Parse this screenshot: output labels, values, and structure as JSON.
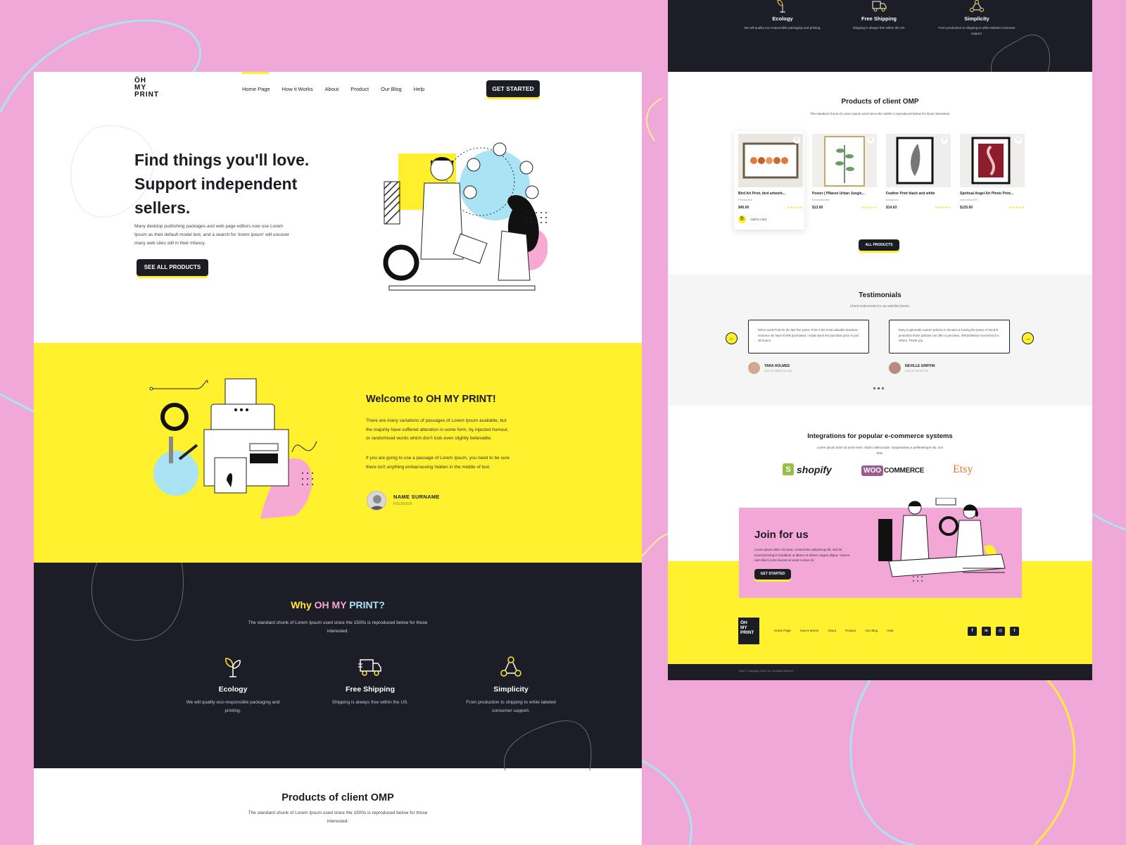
{
  "colors": {
    "background": "#f0a8d8",
    "yellow": "#fff12e",
    "dark": "#1c1d26",
    "pink": "#f3a7d6",
    "cyan": "#a9e3f4"
  },
  "left": {
    "logo": [
      "ÖH",
      "MY",
      "PRINT"
    ],
    "nav": [
      "Home Page",
      "How it Works",
      "About",
      "Product",
      "Our Blog",
      "Help"
    ],
    "get_started": "GET STARTED",
    "hero": {
      "title": "Find things you'll love. Support independent sellers.",
      "desc": "Many desktop publishing packages and web page editors now use Lorem Ipsum as their default model text, and a search for 'lorem ipsum' will uncover many web sites still in their infancy.",
      "cta": "SEE ALL PRODUCTS"
    },
    "welcome": {
      "title": "Welcome to OH MY PRINT!",
      "p1": "There are many variations of passages of Lorem Ipsum available, but the majority have suffered alteration in some form, by injected humour, or randomised words which don't look even slightly believable.",
      "p2": "If you are going to use a passage of Lorem Ipsum, you need to be sure there isn't anything embarrassing hidden in the middle of text.",
      "name": "NAME SURNAME",
      "role": "FOUNDER"
    },
    "why": {
      "title_1": "Why ",
      "title_2": "OH MY ",
      "title_3": "PRINT?",
      "sub": "The standard chunk of Lorem Ipsum used since the 1500s is reproduced below for those interested.",
      "features": [
        {
          "icon": "sprout-icon",
          "title": "Ecology",
          "desc": "We will quality eco-responsible packaging and printing."
        },
        {
          "icon": "truck-icon",
          "title": "Free Shipping",
          "desc": "Shipping is always free within the US."
        },
        {
          "icon": "nodes-icon",
          "title": "Simplicity",
          "desc": "From production to shipping to white labeled consumer support."
        }
      ]
    },
    "products": {
      "title": "Products of client OMP",
      "sub": "The standard chunk of Lorem Ipsum used since the 1500s is reproduced below for those interested."
    }
  },
  "right": {
    "features": [
      {
        "title": "Ecology",
        "desc": "We will quality eco-responsible packaging and printing."
      },
      {
        "title": "Free Shipping",
        "desc": "Shipping is always free within the US."
      },
      {
        "title": "Simplicity",
        "desc": "From production to shipping to white labeled consumer support."
      }
    ],
    "products": {
      "title": "Products of client OMP",
      "sub": "The standard chunk of Lorem Ipsum used since the 1500s is reproduced below for those interested.",
      "items": [
        {
          "name": "Bird Art Print, bird artwork...",
          "seller": "Printandink",
          "price": "$45.00",
          "rating": 5
        },
        {
          "name": "Poster | Pflanze Urban Jungle...",
          "seller": "Elandaskolkid",
          "price": "$13.00",
          "rating": 5
        },
        {
          "name": "Feather Print black and white",
          "seller": "Designoro",
          "price": "$14.63",
          "rating": 5
        },
        {
          "name": "Spiritual Angel Art Photo Print...",
          "seller": "mercedesART",
          "price": "$125.00",
          "rating": 5
        }
      ],
      "add_to_cart": "Add to card",
      "all_products": "ALL PRODUCTS"
    },
    "testimonials": {
      "title": "Testimonials",
      "sub": "Check testimonials for our satisfied clients.",
      "items": [
        {
          "quote": "We've used Print for the last five years. Print is the most valuable business resource we have EVER purchased. I made back the purchase price in just 48 hours!",
          "name": "TARA HOLMES",
          "role": "CEO OF WEBSITE.COM"
        },
        {
          "quote": "Easy to generate custom policies in minutes & having the peace of mind & protection those policies can offer is priceless. Will definitely recommend to others. Thank you.",
          "name": "NEVILLE GRIFFIN",
          "role": "CEO OF SHOP.COM"
        }
      ],
      "prev": "←",
      "next": "→"
    },
    "integrations": {
      "title": "Integrations for popular e-commerce systems",
      "sub": "Lorem ipsum dolor sit amet enim. Etiam ullamcorper. Suspendisse a pellentesque dui, non felis.",
      "shopify": "shopify",
      "woo_1": "WOO",
      "woo_2": "COMMERCE",
      "etsy": "Etsy"
    },
    "join": {
      "title": "Join for us",
      "text": "Lorem ipsum dolor sit amet, consectetur adipiscing elit, sed do eiusmod tempor incididunt ut labore et dolore magna aliqua. Viverra nam libero justo laoreet sit amet cursus sit.",
      "cta": "GET STARTED"
    },
    "footer": {
      "logo": [
        "ÖH",
        "MY",
        "PRINT"
      ],
      "nav": [
        "Home Page",
        "How it Works",
        "About",
        "Product",
        "Our Blog",
        "Help"
      ],
      "social": [
        "f",
        "in",
        "◎",
        "t"
      ],
      "copyright": "Etsy © Copyright 2020, Inc. All rights reserved."
    }
  }
}
